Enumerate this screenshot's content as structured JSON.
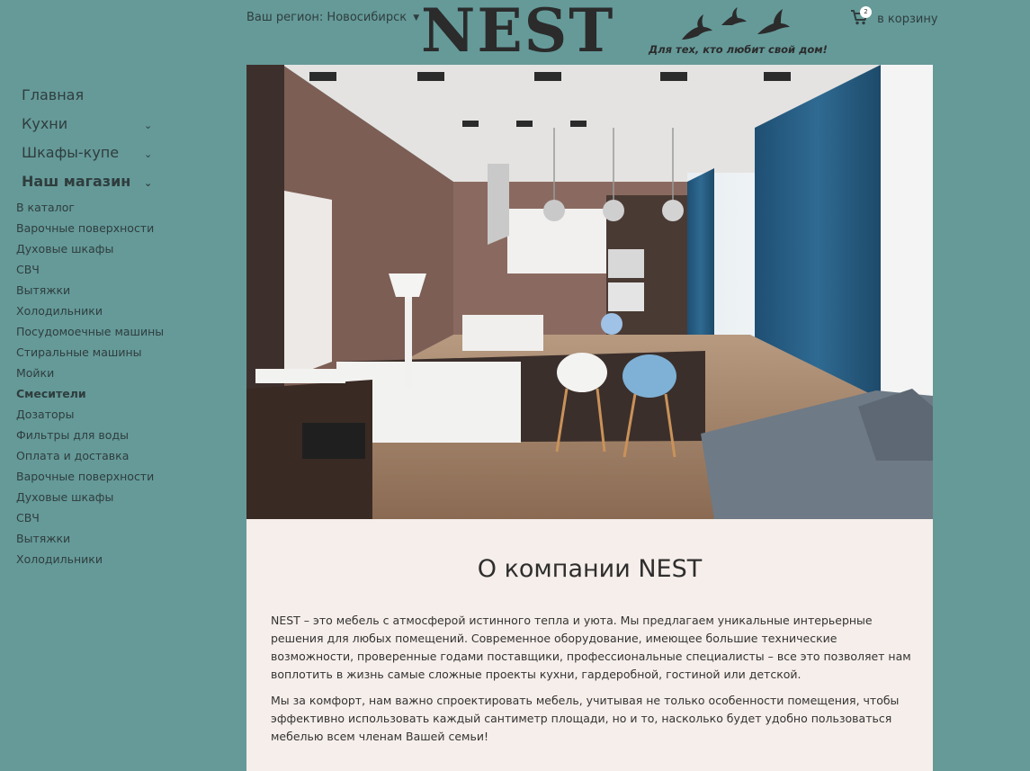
{
  "header": {
    "region_label": "Ваш регион:",
    "region_value": "Новосибирск",
    "logo": {
      "word": "NEST",
      "tagline": "Для тех, кто любит свой дом!"
    },
    "cart": {
      "label": "в корзину",
      "count": "2"
    }
  },
  "sidebar": {
    "menu": [
      {
        "label": "Главная"
      },
      {
        "label": "Кухни"
      },
      {
        "label": "Шкафы-купе"
      },
      {
        "label": "Наш магазин"
      }
    ],
    "submenu": [
      "В каталог",
      "Варочные поверхности",
      "Духовые шкафы",
      "СВЧ",
      "Вытяжки",
      "Холодильники",
      "Посудомоечные машины",
      "Стиральные машины",
      "Мойки",
      "Смесители",
      "Дозаторы",
      "Фильтры для воды",
      "Оплата и доставка",
      "Варочные поверхности",
      "Духовые шкафы",
      "СВЧ",
      "Вытяжки",
      "Холодильники"
    ]
  },
  "content": {
    "title": "О компании NEST",
    "paragraph_1": "NEST – это мебель с атмосферой истинного тепла и уюта. Мы предлагаем уникальные интерьерные решения для любых помещений. Современное оборудование, имеющее большие технические возможности, проверенные годами поставщики, профессиональные специалисты – все это позволяет нам воплотить в жизнь самые сложные проекты кухни, гардеробной, гостиной или детской.",
    "paragraph_2": "Мы за комфорт, нам важно спроектировать мебель, учитывая не только особенности помещения, чтобы эффективно использовать каждый сантиметр площади, но и то, насколько будет удобно пользоваться мебелью всем членам Вашей семьи!"
  },
  "colors": {
    "page_background": "#659a99",
    "content_background": "#f6eeea",
    "text": "#2f3d3d"
  },
  "icons": [
    "caret-down-icon",
    "cart-icon",
    "chevron-down-icon",
    "birds-logo-icon"
  ]
}
